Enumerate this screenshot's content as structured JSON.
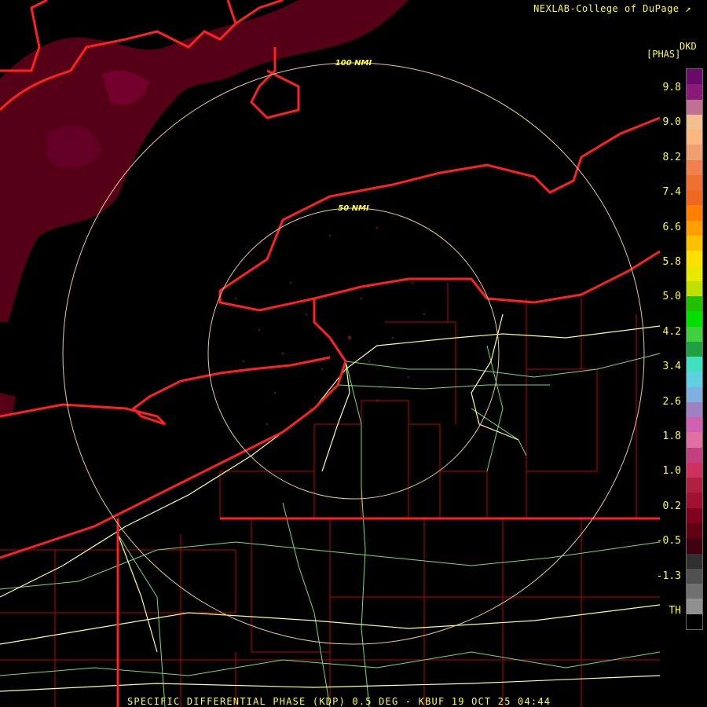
{
  "credit": "NEXLAB-College of DuPage",
  "credit_icon": "external-link-icon",
  "product_code": "DKD",
  "units": "[PHAS]",
  "footer": "SPECIFIC DIFFERENTIAL PHASE (KDP) 0.5 DEG - KBUF 19 OCT 25 04:44",
  "range_rings": [
    {
      "label": "50 NMI"
    },
    {
      "label": "100 NMI"
    }
  ],
  "legend": {
    "ticks": [
      "9.8",
      "9.0",
      "8.2",
      "7.4",
      "6.6",
      "5.8",
      "5.0",
      "4.2",
      "3.4",
      "2.6",
      "1.8",
      "1.0",
      "0.2",
      "-0.5",
      "-1.3",
      "TH"
    ],
    "colors": [
      "#6b0a6b",
      "#8a1a7a",
      "#c07090",
      "#f0c090",
      "#f8b880",
      "#f0a070",
      "#f08050",
      "#f07030",
      "#f06820",
      "#ff8000",
      "#ffa000",
      "#ffc000",
      "#ffe000",
      "#e8e800",
      "#c0e000",
      "#20c000",
      "#00e000",
      "#40d040",
      "#20a040",
      "#40e0c0",
      "#60d0e0",
      "#80b0e0",
      "#a080c0",
      "#d060b0",
      "#e070a0",
      "#c04080",
      "#d03060",
      "#b02040",
      "#a01030",
      "#800020",
      "#600010",
      "#400010",
      "#303030",
      "#505050",
      "#707070",
      "#909090",
      "#000000"
    ]
  },
  "colors": {
    "state_border": "#ff2020",
    "county_border": "#c00000",
    "highway": "#ffff80",
    "road_secondary": "#70e070",
    "ring": "#e8c890",
    "text": "#ffff33"
  }
}
